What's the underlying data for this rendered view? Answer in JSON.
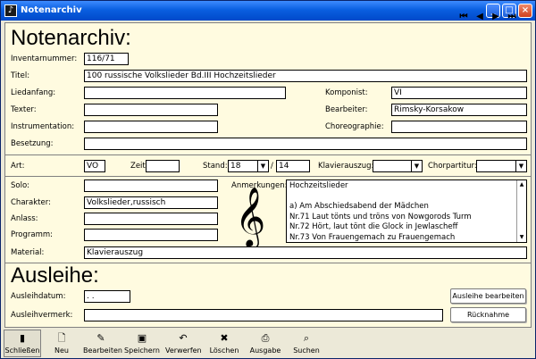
{
  "window": {
    "title": "Notenarchiv",
    "app_icon": "music-note-icon",
    "min": "_",
    "max": "□",
    "close": "×"
  },
  "header": {
    "title": "Notenarchiv:"
  },
  "labels": {
    "inventarnummer": "Inventarnummer:",
    "titel": "Titel:",
    "liedanfang": "Liedanfang:",
    "texter": "Texter:",
    "instrumentation": "Instrumentation:",
    "besetzung": "Besetzung:",
    "komponist": "Komponist:",
    "bearbeiter": "Bearbeiter:",
    "choreographie": "Choreographie:",
    "art": "Art:",
    "zeit": "Zeit:",
    "stand": "Stand:",
    "stand_sep": "/",
    "klavierauszug": "Klavierauszug:",
    "chorpartitur": "Chorpartitur:",
    "solo": "Solo:",
    "charakter": "Charakter:",
    "anlass": "Anlass:",
    "programm": "Programm:",
    "anmerkungen": "Anmerkungen:",
    "material": "Material:",
    "ausleihdatum": "Ausleihdatum:",
    "ausleihvermerk": "Ausleihvermerk:"
  },
  "values": {
    "inventarnummer": "116/71",
    "titel": "100 russische Volkslieder Bd.III Hochzeitslieder",
    "liedanfang": "",
    "texter": "",
    "instrumentation": "",
    "besetzung": "",
    "komponist": "VI",
    "bearbeiter": "Rimsky-Korsakow",
    "choreographie": "",
    "art": "VO",
    "zeit": "",
    "stand": "18",
    "stand_total": "14",
    "klavierauszug": "",
    "chorpartitur": "",
    "solo": "",
    "charakter": "Volkslieder,russisch",
    "anlass": "",
    "programm": "",
    "material": "Klavierauszug",
    "ausleihdatum": " . .",
    "ausleihvermerk": ""
  },
  "anmerkungen_lines": [
    "Hochzeitslieder",
    "",
    "a) Am Abschiedsabend der Mädchen",
    "Nr.71 Laut tönts und tröns von Nowgorods Turm",
    "Nr.72 Hört, laut tönt die Glock in Jewlascheff",
    "Nr.73 Von Frauengemach zu Frauengemach"
  ],
  "ausleihe": {
    "title": "Ausleihe:",
    "edit_button": "Ausleihe bearbeiten",
    "return_button": "Rücknahme"
  },
  "clef_icon": "𝄞",
  "toolbar": [
    {
      "label": "Schließen",
      "icon": "door-icon",
      "glyph": "▮"
    },
    {
      "label": "Neu",
      "icon": "new-document-icon",
      "glyph": "🗋"
    },
    {
      "label": "Bearbeiten",
      "icon": "edit-icon",
      "glyph": "✎"
    },
    {
      "label": "Speichern",
      "icon": "save-icon",
      "glyph": "▣"
    },
    {
      "label": "Verwerfen",
      "icon": "undo-icon",
      "glyph": "↶"
    },
    {
      "label": "Löschen",
      "icon": "delete-icon",
      "glyph": "✖"
    },
    {
      "label": "Ausgabe",
      "icon": "print-icon",
      "glyph": "⎙"
    },
    {
      "label": "Suchen",
      "icon": "search-icon",
      "glyph": "⌕"
    }
  ],
  "nav": {
    "first": "⏮",
    "prev": "◀",
    "next": "▶",
    "last": "⏭"
  }
}
